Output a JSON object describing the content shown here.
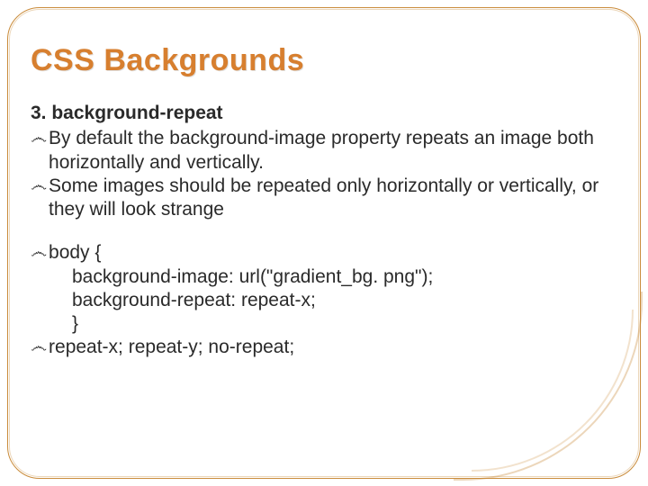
{
  "title": "CSS Backgrounds",
  "subhead": "3. background-repeat",
  "bullets": {
    "b1": "By default the background-image property repeats an image both horizontally and vertically.",
    "b2": "Some images should be repeated only horizontally or vertically, or they will look strange",
    "b3_line1": "body {",
    "b3_line2": "background-image: url(\"gradient_bg. png\");",
    "b3_line3": "background-repeat: repeat-x;",
    "b3_line4": "}",
    "b4": "repeat-x; repeat-y; no-repeat;"
  },
  "bullet_glyph": "෴"
}
